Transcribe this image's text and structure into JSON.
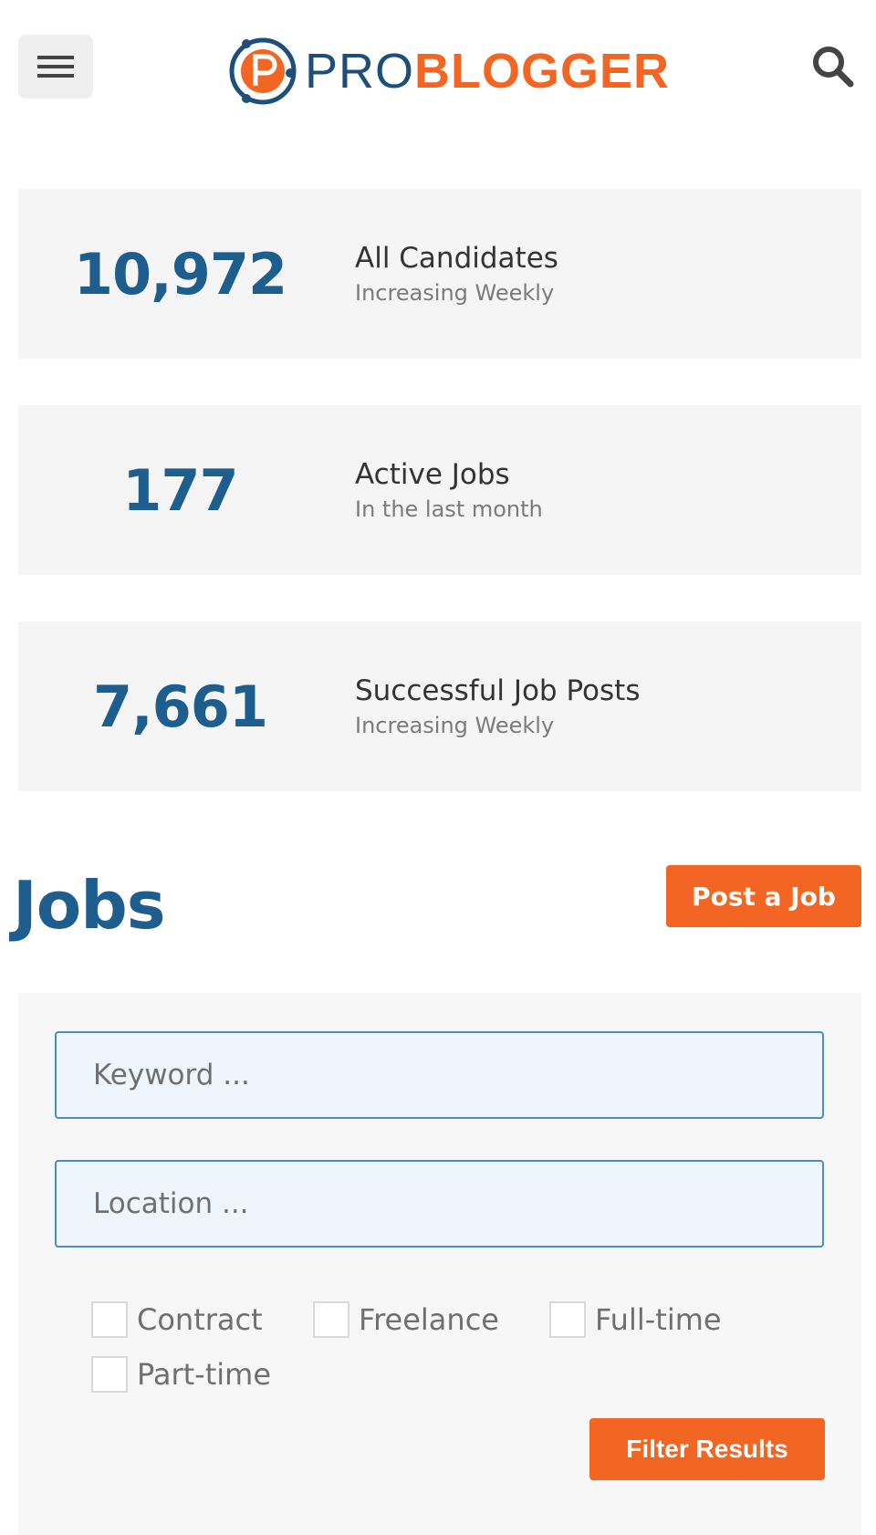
{
  "header": {
    "logo": {
      "pro": "PRO",
      "blogger": "BLOGGER"
    },
    "menu_icon": "hamburger-icon",
    "search_icon": "search-icon"
  },
  "stats": [
    {
      "number": "10,972",
      "title": "All Candidates",
      "subtitle": "Increasing Weekly"
    },
    {
      "number": "177",
      "title": "Active Jobs",
      "subtitle": "In the last month"
    },
    {
      "number": "7,661",
      "title": "Successful Job Posts",
      "subtitle": "Increasing Weekly"
    }
  ],
  "jobs": {
    "title": "Jobs",
    "post_button": "Post a Job"
  },
  "filter": {
    "keyword_placeholder": "Keyword ...",
    "location_placeholder": "Location ...",
    "job_types": [
      "Contract",
      "Freelance",
      "Full-time",
      "Part-time"
    ],
    "submit": "Filter Results"
  },
  "colors": {
    "brand_blue": "#1e5e8e",
    "brand_orange": "#f26522"
  }
}
